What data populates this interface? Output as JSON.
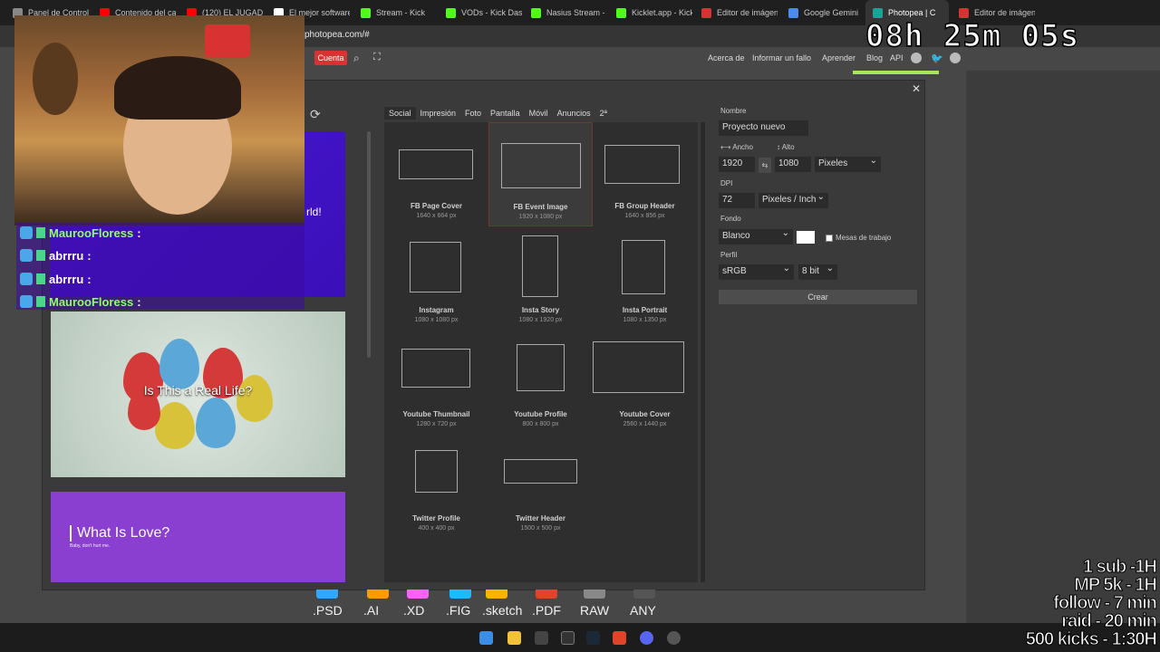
{
  "browser": {
    "tabs": [
      {
        "label": "Panel de Control",
        "color": "#888888"
      },
      {
        "label": "Contenido del ca",
        "color": "#ff0000"
      },
      {
        "label": "(120) EL JUGADO",
        "color": "#ff0000"
      },
      {
        "label": "El mejor software",
        "color": "#ffffff"
      },
      {
        "label": "Stream - Kick",
        "color": "#53fc18"
      },
      {
        "label": "VODs - Kick Dash",
        "color": "#53fc18"
      },
      {
        "label": "Nasius Stream - Y",
        "color": "#53fc18"
      },
      {
        "label": "Kicklet.app - Kick",
        "color": "#53fc18"
      },
      {
        "label": "Editor de imágen",
        "color": "#d83232"
      },
      {
        "label": "Google Gemini",
        "color": "#4a8cf0"
      },
      {
        "label": "Photopea | C",
        "color": "#18a497"
      },
      {
        "label": "Editor de imágen",
        "color": "#d83232"
      }
    ],
    "url": "photopea.com/#"
  },
  "topbar": {
    "cuenta": "Cuenta",
    "links": [
      "Acerca de",
      "Informar un fallo",
      "Aprender",
      "Blog",
      "API"
    ]
  },
  "templates": {
    "tabs": [
      "Social",
      "Impresión",
      "Foto",
      "Pantalla",
      "Móvil",
      "Anuncios",
      "2ª"
    ],
    "items": [
      {
        "name": "FB Page Cover",
        "size": "1640 x 664 px"
      },
      {
        "name": "FB Event Image",
        "size": "1920 x 1080 px"
      },
      {
        "name": "FB Group Header",
        "size": "1640 x 856 px"
      },
      {
        "name": "Instagram",
        "size": "1080 x 1080 px"
      },
      {
        "name": "Insta Story",
        "size": "1080 x 1920 px"
      },
      {
        "name": "Insta Portrait",
        "size": "1080 x 1350 px"
      },
      {
        "name": "Youtube Thumbnail",
        "size": "1280 x 720 px"
      },
      {
        "name": "Youtube Profile",
        "size": "800 x 800 px"
      },
      {
        "name": "Youtube Cover",
        "size": "2560 x 1440 px"
      },
      {
        "name": "Twitter Profile",
        "size": "400 x 400 px"
      },
      {
        "name": "Twitter Header",
        "size": "1500 x 500 px"
      }
    ]
  },
  "form": {
    "nombre_label": "Nombre",
    "nombre_value": "Proyecto nuevo",
    "ancho_label": "Ancho",
    "alto_label": "Alto",
    "ancho_value": "1920",
    "alto_value": "1080",
    "unit": "Pixeles",
    "dpi_label": "DPI",
    "dpi_value": "72",
    "dpi_unit": "Pixeles / Inch",
    "fondo_label": "Fondo",
    "fondo_value": "Blanco",
    "mesas": "Mesas de trabajo",
    "perfil_label": "Perfil",
    "perfil_value": "sRGB",
    "bits": "8 bit",
    "crear": "Crear"
  },
  "previews": {
    "thumb1_text": "rld!",
    "thumb2_title": "Is This a Real Life?",
    "thumb3_title": "What Is Love?",
    "thumb3_sub": "Baby, don't hurt me."
  },
  "formats": [
    ".PSD",
    ".AI",
    ".XD",
    ".FIG",
    ".sketch",
    ".PDF",
    "RAW",
    "ANY"
  ],
  "overlay": {
    "timer": "08h 25m 05s",
    "goals": [
      "1 sub -1H",
      "MP 5k - 1H",
      "follow - 7 min",
      "raid - 20 min",
      "500 kicks - 1:30H"
    ],
    "chat": [
      {
        "user": "MaurooFloress",
        "color": "#8dff6a",
        "msg": ":"
      },
      {
        "user": "abrrru",
        "color": "#ffffff",
        "msg": ":"
      },
      {
        "user": "abrrru",
        "color": "#ffffff",
        "msg": ":"
      },
      {
        "user": "MaurooFloress",
        "color": "#8dff6a",
        "msg": ":"
      }
    ]
  }
}
